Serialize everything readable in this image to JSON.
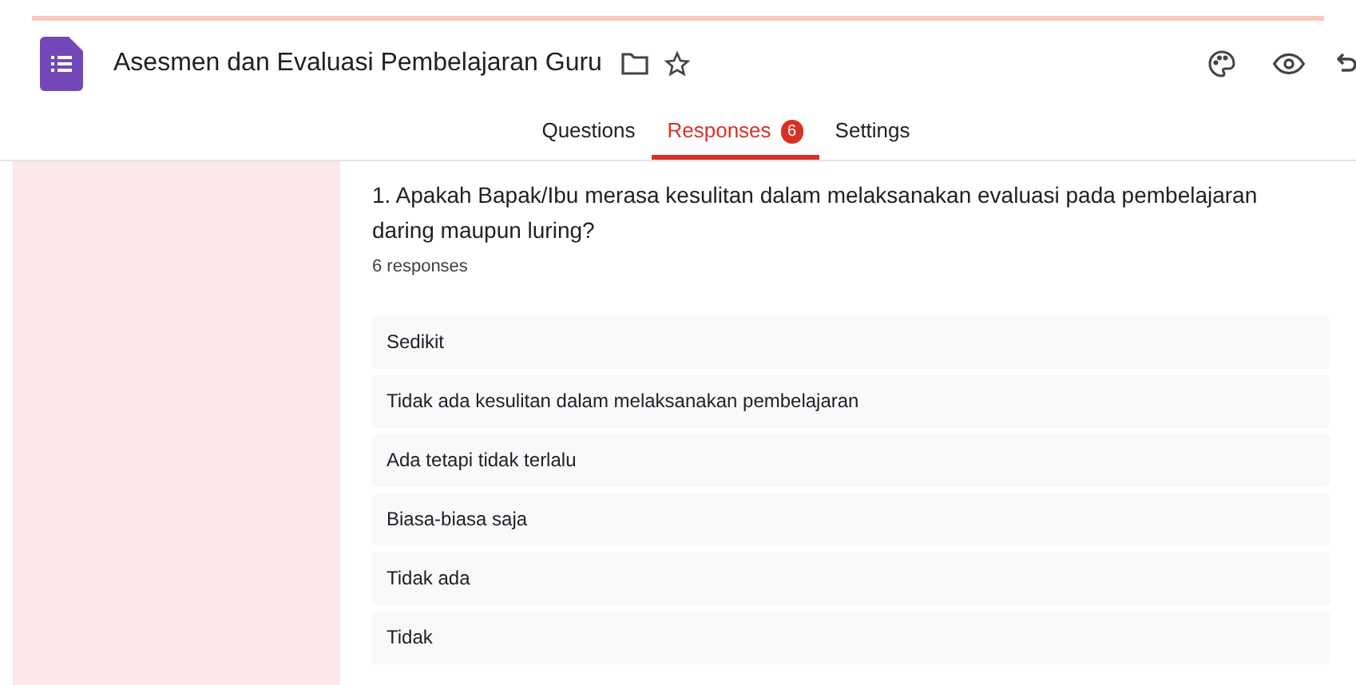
{
  "header": {
    "title": "Asesmen dan Evaluasi Pembelajaran Guru"
  },
  "tabs": [
    {
      "label": "Questions",
      "selected": false
    },
    {
      "label": "Responses",
      "selected": true,
      "badge": "6"
    },
    {
      "label": "Settings",
      "selected": false
    }
  ],
  "question": {
    "title": "1. Apakah Bapak/Ibu merasa kesulitan dalam melaksanakan evaluasi pada pembelajaran daring maupun luring?",
    "count": "6 responses",
    "answers": [
      "Sedikit",
      "Tidak ada kesulitan dalam melaksanakan pembelajaran",
      "Ada tetapi tidak terlalu",
      "Biasa-biasa saja",
      "Tidak ada",
      "Tidak"
    ]
  }
}
